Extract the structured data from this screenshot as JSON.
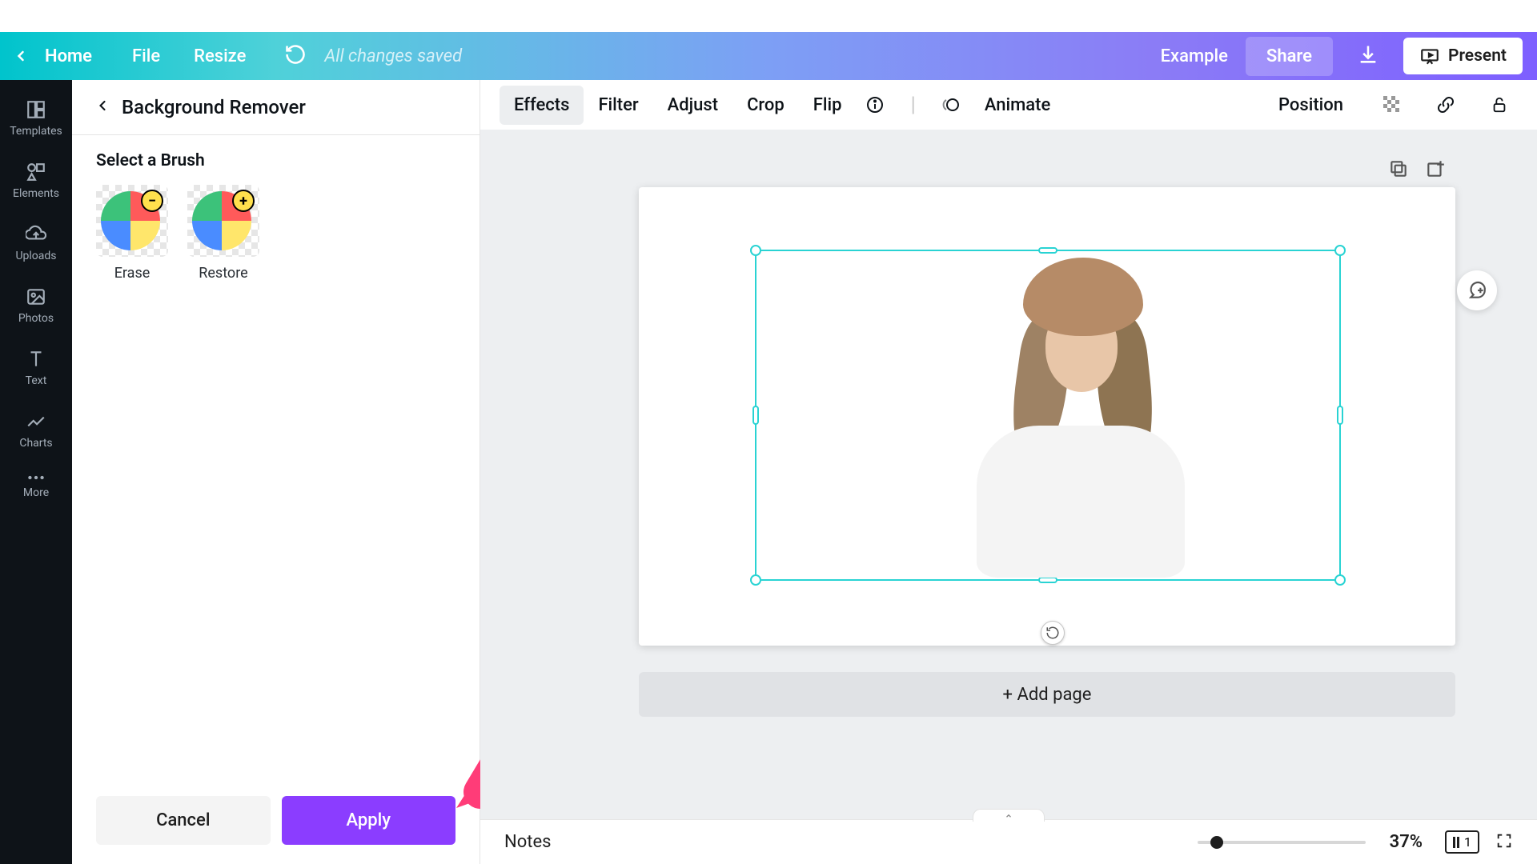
{
  "top_nav": {
    "home": "Home",
    "file": "File",
    "resize": "Resize",
    "saved_status": "All changes saved",
    "example": "Example",
    "share": "Share",
    "present": "Present"
  },
  "sidebar": {
    "items": [
      {
        "label": "Templates"
      },
      {
        "label": "Elements"
      },
      {
        "label": "Uploads"
      },
      {
        "label": "Photos"
      },
      {
        "label": "Text"
      },
      {
        "label": "Charts"
      },
      {
        "label": "More"
      }
    ]
  },
  "bg_panel": {
    "title": "Background Remover",
    "select_brush": "Select a Brush",
    "brushes": [
      {
        "name": "Erase"
      },
      {
        "name": "Restore"
      }
    ],
    "cancel": "Cancel",
    "apply": "Apply"
  },
  "toolbar": {
    "effects": "Effects",
    "filter": "Filter",
    "adjust": "Adjust",
    "crop": "Crop",
    "flip": "Flip",
    "animate": "Animate",
    "position": "Position"
  },
  "canvas": {
    "add_page": "+ Add page"
  },
  "bottom": {
    "notes": "Notes",
    "zoom": "37%",
    "page_count": "1"
  }
}
